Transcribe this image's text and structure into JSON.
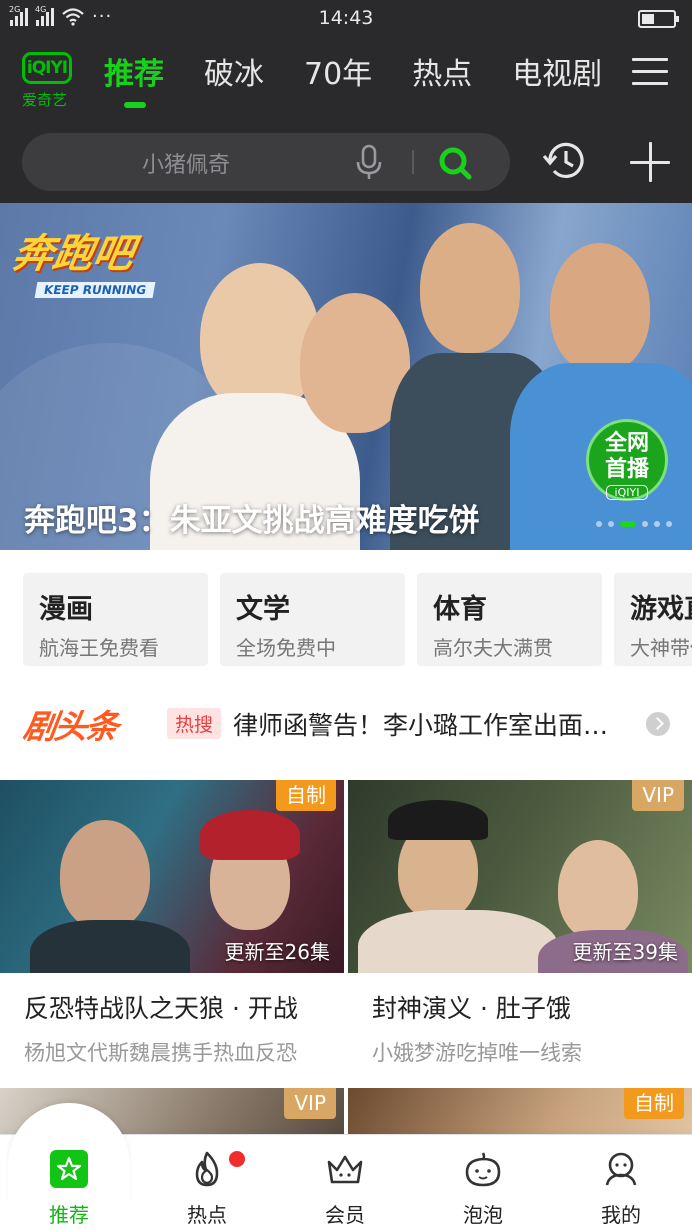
{
  "status_bar": {
    "signal1_label": "2G",
    "signal2_label": "4G",
    "more": "···",
    "time": "14:43",
    "battery_level": 0.4
  },
  "header": {
    "logo_text": "iQIYI",
    "logo_subtitle": "爱奇艺",
    "tabs": [
      {
        "label": "推荐",
        "active": true
      },
      {
        "label": "破冰"
      },
      {
        "label": "70年"
      },
      {
        "label": "热点"
      },
      {
        "label": "电视剧"
      }
    ],
    "search_placeholder": "小猪佩奇"
  },
  "banner": {
    "title": "奔跑吧3：朱亚文挑战高难度吃饼",
    "show_logo_text": "奔跑吧",
    "show_logo_sub": "KEEP RUNNING",
    "badge_line1": "全网",
    "badge_line2": "首播",
    "badge_brand": "iQIYI",
    "slide_count": 6,
    "active_slide": 2
  },
  "shortcuts": [
    {
      "title": "漫画",
      "subtitle": "航海王免费看"
    },
    {
      "title": "文学",
      "subtitle": "全场免费中"
    },
    {
      "title": "体育",
      "subtitle": "高尔夫大满贯"
    },
    {
      "title": "游戏直播",
      "subtitle": "大神带你飞"
    }
  ],
  "headline": {
    "brand": "剧头条",
    "tag": "热搜",
    "text": "律师函警告！李小璐工作室出面…"
  },
  "videos": [
    {
      "title": "反恐特战队之天狼 · 开战",
      "subtitle": "杨旭文代斯魏晨携手热血反恐",
      "badge": "自制",
      "badge_color": "#f39a1d",
      "update": "更新至26集"
    },
    {
      "title": "封神演义 · 肚子饿",
      "subtitle": "小娥梦游吃掉唯一线索",
      "badge": "VIP",
      "badge_color": "#d8a764",
      "update": "更新至39集"
    },
    {
      "badge": "VIP",
      "badge_color": "#d8a764"
    },
    {
      "badge": "自制",
      "badge_color": "#f39a1d"
    }
  ],
  "bottom_nav": [
    {
      "label": "推荐",
      "icon": "home-star-icon",
      "active": true
    },
    {
      "label": "热点",
      "icon": "flame-icon",
      "has_dot": true
    },
    {
      "label": "会员",
      "icon": "crown-icon"
    },
    {
      "label": "泡泡",
      "icon": "bubble-face-icon"
    },
    {
      "label": "我的",
      "icon": "profile-icon"
    }
  ],
  "colors": {
    "brand_green": "#19d11b",
    "header_bg": "#2a2a2c",
    "headline_orange": "#ff5a1f"
  }
}
